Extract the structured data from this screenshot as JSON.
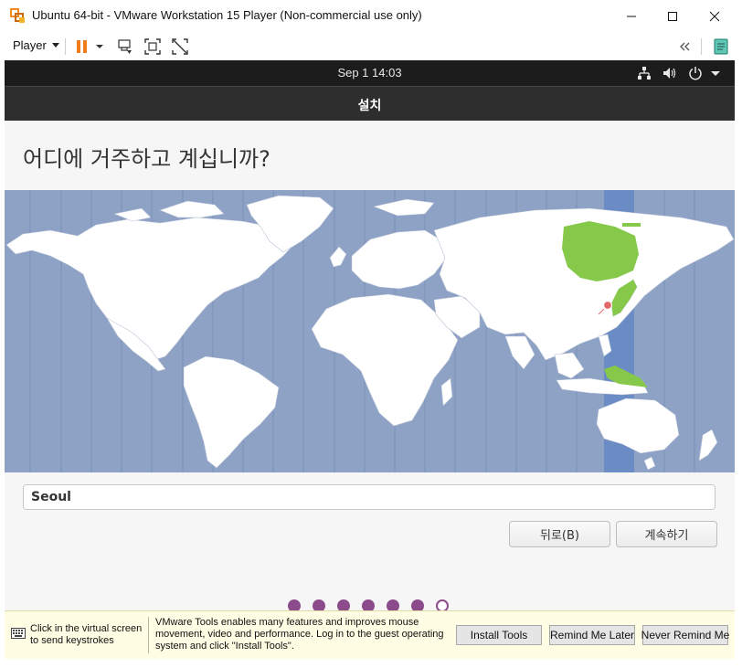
{
  "window": {
    "title": "Ubuntu 64-bit - VMware Workstation 15 Player (Non-commercial use only)",
    "controls": [
      "minimize-icon",
      "maximize-icon",
      "close-icon"
    ]
  },
  "toolbar": {
    "player_label": "Player",
    "icons": [
      "pause-icon",
      "send-ctrl-alt-del-icon",
      "fit-guest-icon",
      "unity-icon",
      "collapse-icon",
      "library-icon"
    ],
    "accent_color": "#f07d1a"
  },
  "guest": {
    "clock": "Sep 1  14:03",
    "status_icons": [
      "network-icon",
      "volume-icon",
      "power-icon",
      "menu-arrow-icon"
    ],
    "header_title": "설치",
    "question": "어디에 거주하고 계십니까?",
    "timezone_value": "Seoul",
    "back_button": "뒤로(B)",
    "continue_button": "계속하기",
    "progress_steps_total": 7,
    "progress_steps_done": 6,
    "map_colors": {
      "ocean": "#8ea2c6",
      "selected_zone": "#6b8bc4",
      "highlight_land": "#86c94a",
      "land": "#ffffff"
    }
  },
  "tools_bar": {
    "keyboard_hint": "Click in the virtual screen to send keystrokes",
    "message": "VMware Tools enables many features and improves mouse movement, video and performance. Log in to the guest operating system and click \"Install Tools\".",
    "install_button": "Install Tools",
    "remind_button": "Remind Me Later",
    "never_button": "Never Remind Me"
  }
}
